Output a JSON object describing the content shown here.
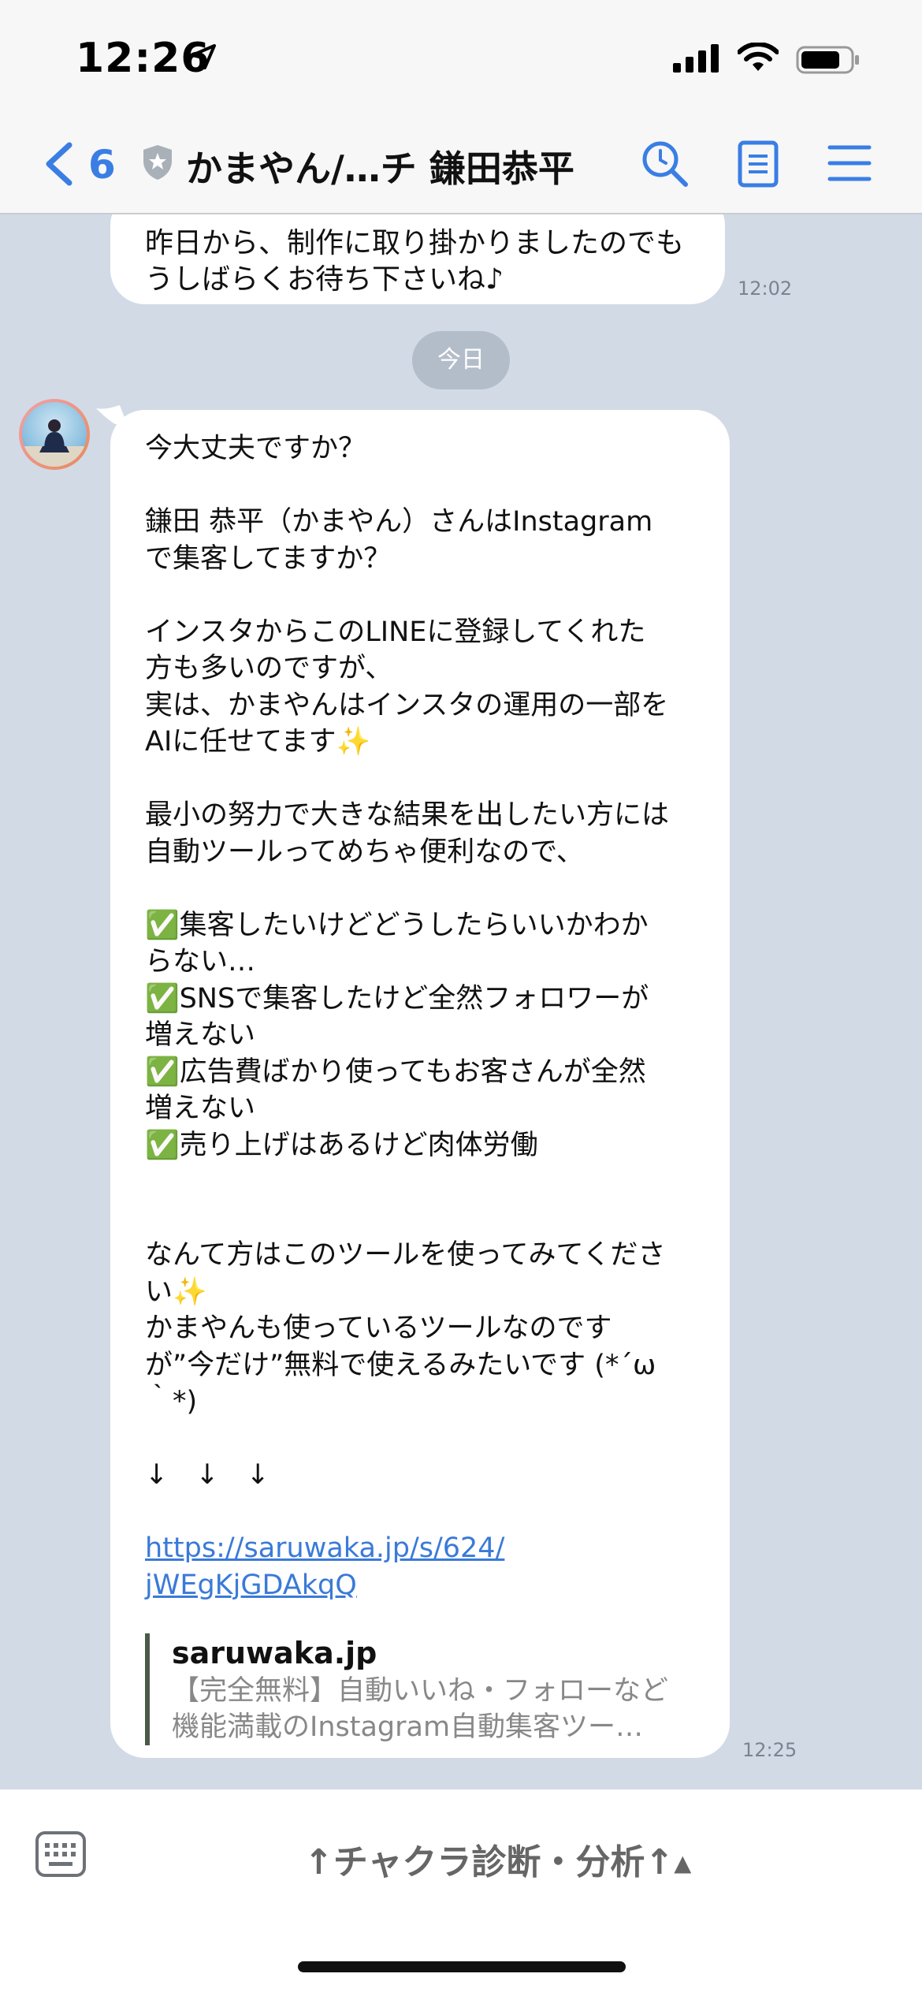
{
  "status": {
    "time": "12:26"
  },
  "nav": {
    "back_count": "6",
    "title": "かまやん/…チ 鎌田恭平"
  },
  "previous_message": {
    "lines": [
      "昨日から、制作に取り掛かりましたのでも",
      "うしばらくお待ち下さいね♪"
    ],
    "time": "12:02"
  },
  "date_separator": "今日",
  "message": {
    "lines": [
      "今大丈夫ですか？",
      "",
      "鎌田 恭平（かまやん）さんはInstagram",
      "で集客してますか？",
      "",
      "インスタからこのLINEに登録してくれた",
      "方も多いのですが、",
      "実は、かまやんはインスタの運用の一部を",
      "AIに任せてます✨",
      "",
      "最小の努力で大きな結果を出したい方には",
      "自動ツールってめちゃ便利なので、",
      "",
      "✅集客したいけどどうしたらいいかわか",
      "らない…",
      "✅SNSで集客したけど全然フォロワーが",
      "増えない",
      "✅広告費ばかり使ってもお客さんが全然",
      "増えない",
      "✅売り上げはあるけど肉体労働",
      "",
      "",
      "なんて方はこのツールを使ってみてくださ",
      "い✨",
      "かまやんも使っているツールなのです",
      "が”今だけ”無料で使えるみたいです (*´ω",
      "｀*)",
      "",
      "↓　↓　↓",
      ""
    ],
    "link_lines": [
      "https://saruwaka.jp/s/624/",
      "jWEgKjGDAkqQ"
    ],
    "preview": {
      "domain": "saruwaka.jp",
      "desc_lines": [
        "【完全無料】自動いいね・フォローなど",
        "機能満載のInstagram自動集客ツー…"
      ]
    },
    "time": "12:25"
  },
  "bottom": {
    "rich_menu_label": "↑チャクラ診断・分析↑▴"
  },
  "colors": {
    "accent": "#3a7ee4",
    "chat_bg": "#d2dae6",
    "check": "#35b34a",
    "link": "#3a7ad8"
  }
}
